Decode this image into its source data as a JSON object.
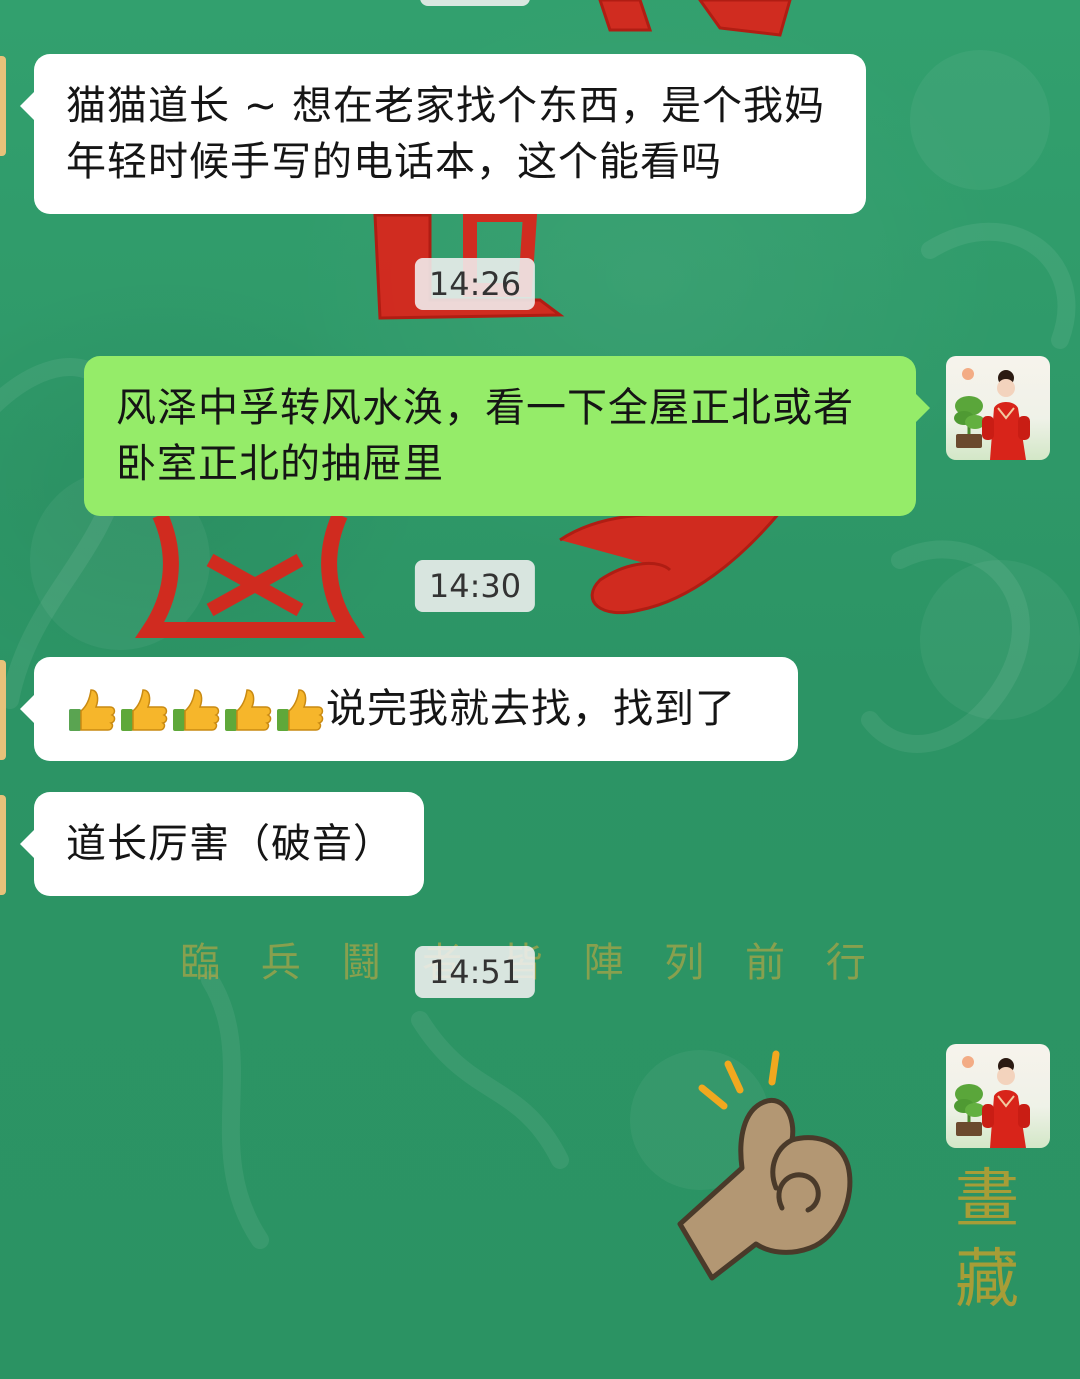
{
  "messages": [
    {
      "direction": "incoming",
      "text": "猫猫道长 ~ 想在老家找个东西，是个我妈年轻时候手写的电话本，这个能看吗"
    },
    {
      "direction": "timestamp",
      "text": "14:26"
    },
    {
      "direction": "outgoing",
      "text": "风泽中孚转风水涣，看一下全屋正北或者卧室正北的抽屉里"
    },
    {
      "direction": "timestamp",
      "text": "14:30"
    },
    {
      "direction": "incoming",
      "emoji": "thumbs-up",
      "emoji_count": 5,
      "text": "说完我就去找，找到了"
    },
    {
      "direction": "incoming",
      "text": "道长厉害（破音）"
    },
    {
      "direction": "timestamp",
      "text": "14:51"
    },
    {
      "direction": "outgoing",
      "sticker": "clapping-hand-sticker"
    }
  ],
  "background": {
    "theme": "green-chinese-talisman-wallpaper",
    "base_color": "#2f9b6a",
    "accent_red": "#d9261c",
    "accent_gold": "#d5aa3c",
    "bottom_text": "臨 兵 鬪 者 皆 陣 列 前 行",
    "side_text": "畫藏"
  },
  "colors": {
    "incoming_bubble": "#ffffff",
    "outgoing_bubble": "#95ec69",
    "timestamp_bg": "#f0f0f0"
  }
}
